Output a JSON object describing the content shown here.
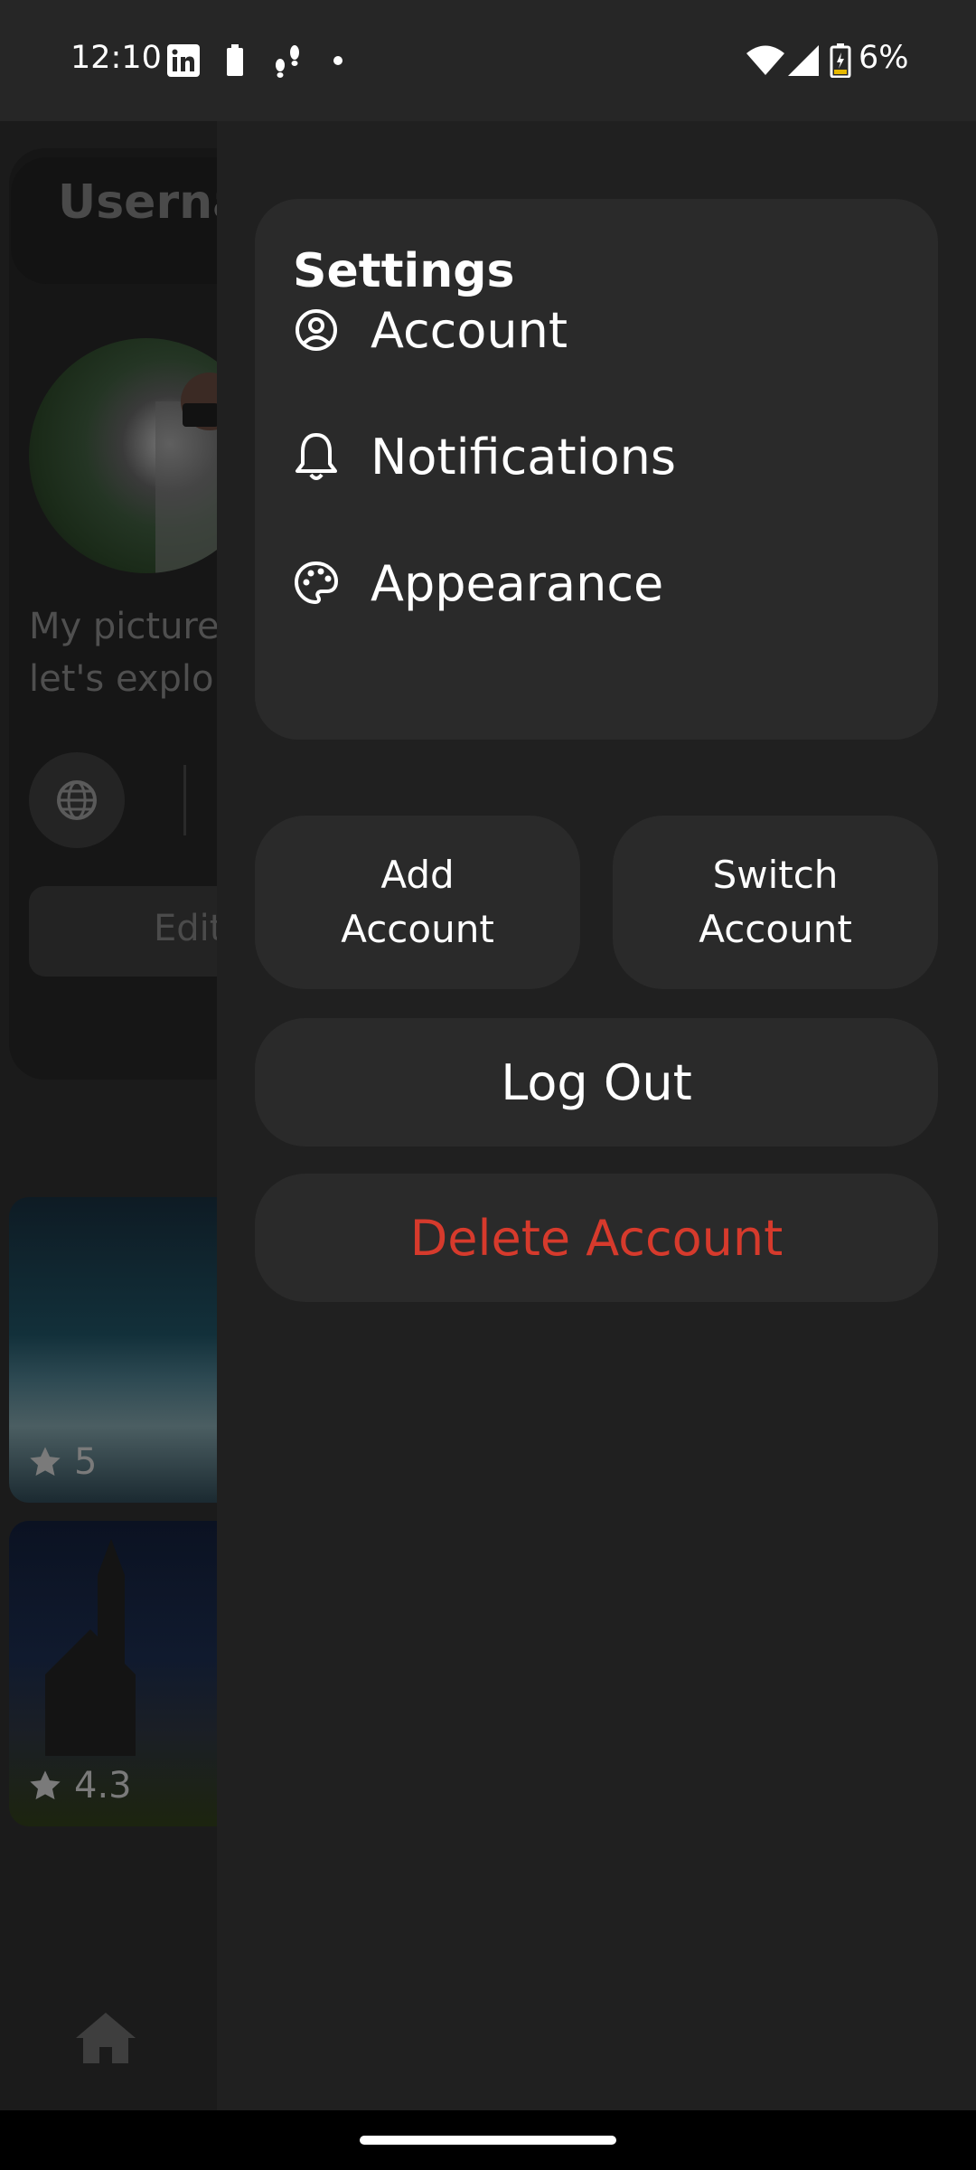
{
  "status_bar": {
    "time": "12:10",
    "battery_percent": "6%",
    "icons": [
      "linkedin-icon",
      "battery-small-icon",
      "footprints-icon",
      "dot-icon",
      "wifi-icon",
      "signal-icon",
      "battery-charging-icon"
    ]
  },
  "background": {
    "username": "Userna",
    "bio": "My picture\nlet's explor",
    "edit_label": "Edit",
    "gallery": [
      {
        "rating": "5"
      },
      {
        "rating": "4.3"
      }
    ]
  },
  "drawer": {
    "settings_title": "Settings",
    "items": [
      {
        "label": "Account",
        "icon": "account-circle-icon"
      },
      {
        "label": "Notifications",
        "icon": "bell-icon"
      },
      {
        "label": "Appearance",
        "icon": "palette-icon"
      }
    ],
    "add_account_label": "Add\nAccount",
    "switch_account_label": "Switch\nAccount",
    "logout_label": "Log Out",
    "delete_account_label": "Delete Account"
  },
  "colors": {
    "drawer_bg": "#202020",
    "card_bg": "#2a2a2a",
    "danger": "#d63a2c"
  }
}
